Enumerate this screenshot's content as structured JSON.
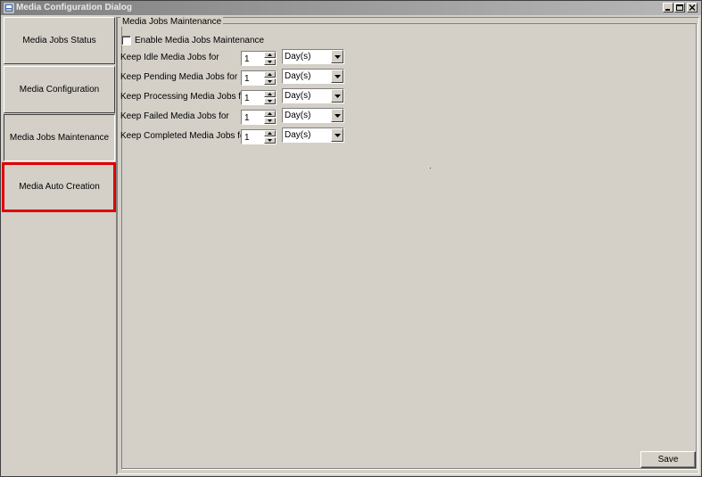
{
  "window": {
    "title": "Media Configuration Dialog",
    "controls": [
      "minimize-icon",
      "maximize-icon",
      "close-icon"
    ]
  },
  "sidebar": {
    "items": [
      {
        "label": "Media Jobs Status"
      },
      {
        "label": "Media Configuration"
      },
      {
        "label": "Media Jobs Maintenance"
      },
      {
        "label": "Media Auto Creation"
      }
    ],
    "active_index": 2,
    "highlight_color": "#e00000"
  },
  "maintenance": {
    "group_title": "Media Jobs Maintenance",
    "enable_label": "Enable Media Jobs Maintenance",
    "enable_checked": false,
    "rows": [
      {
        "label": "Keep Idle Media Jobs for",
        "value": "1",
        "unit": "Day(s)"
      },
      {
        "label": "Keep Pending Media Jobs for",
        "value": "1",
        "unit": "Day(s)"
      },
      {
        "label": "Keep Processing Media Jobs for",
        "value": "1",
        "unit": "Day(s)"
      },
      {
        "label": "Keep Failed Media Jobs for",
        "value": "1",
        "unit": "Day(s)"
      },
      {
        "label": "Keep Completed Media Jobs for",
        "value": "1",
        "unit": "Day(s)"
      }
    ]
  },
  "footer": {
    "save_label": "Save"
  }
}
